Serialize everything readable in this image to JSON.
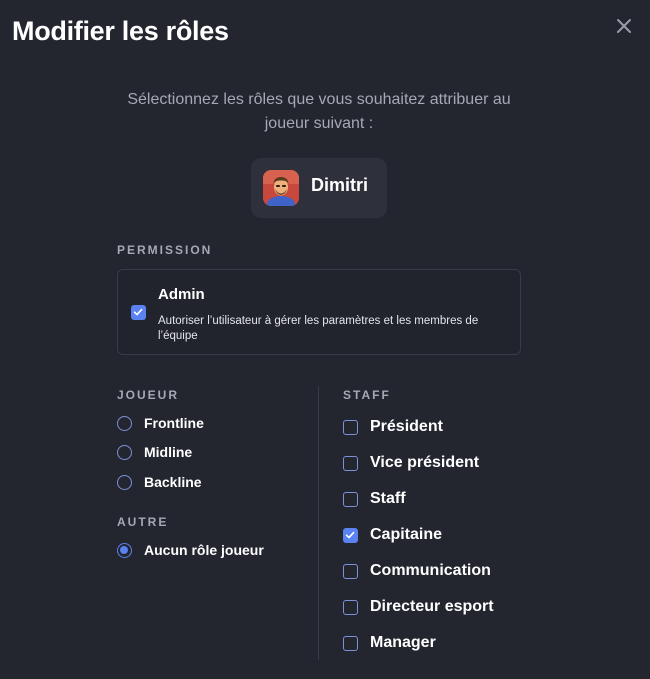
{
  "dialog": {
    "title": "Modifier les rôles",
    "close_icon": "close-icon",
    "subtitle_line1": "Sélectionnez les rôles que vous souhaitez attribuer au",
    "subtitle_line2": "joueur suivant :"
  },
  "player": {
    "name": "Dimitri",
    "avatar_icon": "player-avatar"
  },
  "permission": {
    "section_label": "PERMISSION",
    "admin": {
      "label": "Admin",
      "description": "Autoriser l’utilisateur à gérer les paramètres et les membres de l’équipe",
      "checked": true
    }
  },
  "joueur": {
    "section_label": "JOUEUR",
    "options": [
      {
        "label": "Frontline",
        "selected": false
      },
      {
        "label": "Midline",
        "selected": false
      },
      {
        "label": "Backline",
        "selected": false
      }
    ]
  },
  "autre": {
    "section_label": "AUTRE",
    "options": [
      {
        "label": "Aucun rôle joueur",
        "selected": true
      }
    ]
  },
  "staff": {
    "section_label": "STAFF",
    "options": [
      {
        "label": "Président",
        "checked": false
      },
      {
        "label": "Vice président",
        "checked": false
      },
      {
        "label": "Staff",
        "checked": false
      },
      {
        "label": "Capitaine",
        "checked": true
      },
      {
        "label": "Communication",
        "checked": false
      },
      {
        "label": "Directeur esport",
        "checked": false
      },
      {
        "label": "Manager",
        "checked": false
      }
    ]
  },
  "colors": {
    "background": "#23252f",
    "accent": "#5a82f0",
    "muted_text": "#a6a8b3"
  }
}
